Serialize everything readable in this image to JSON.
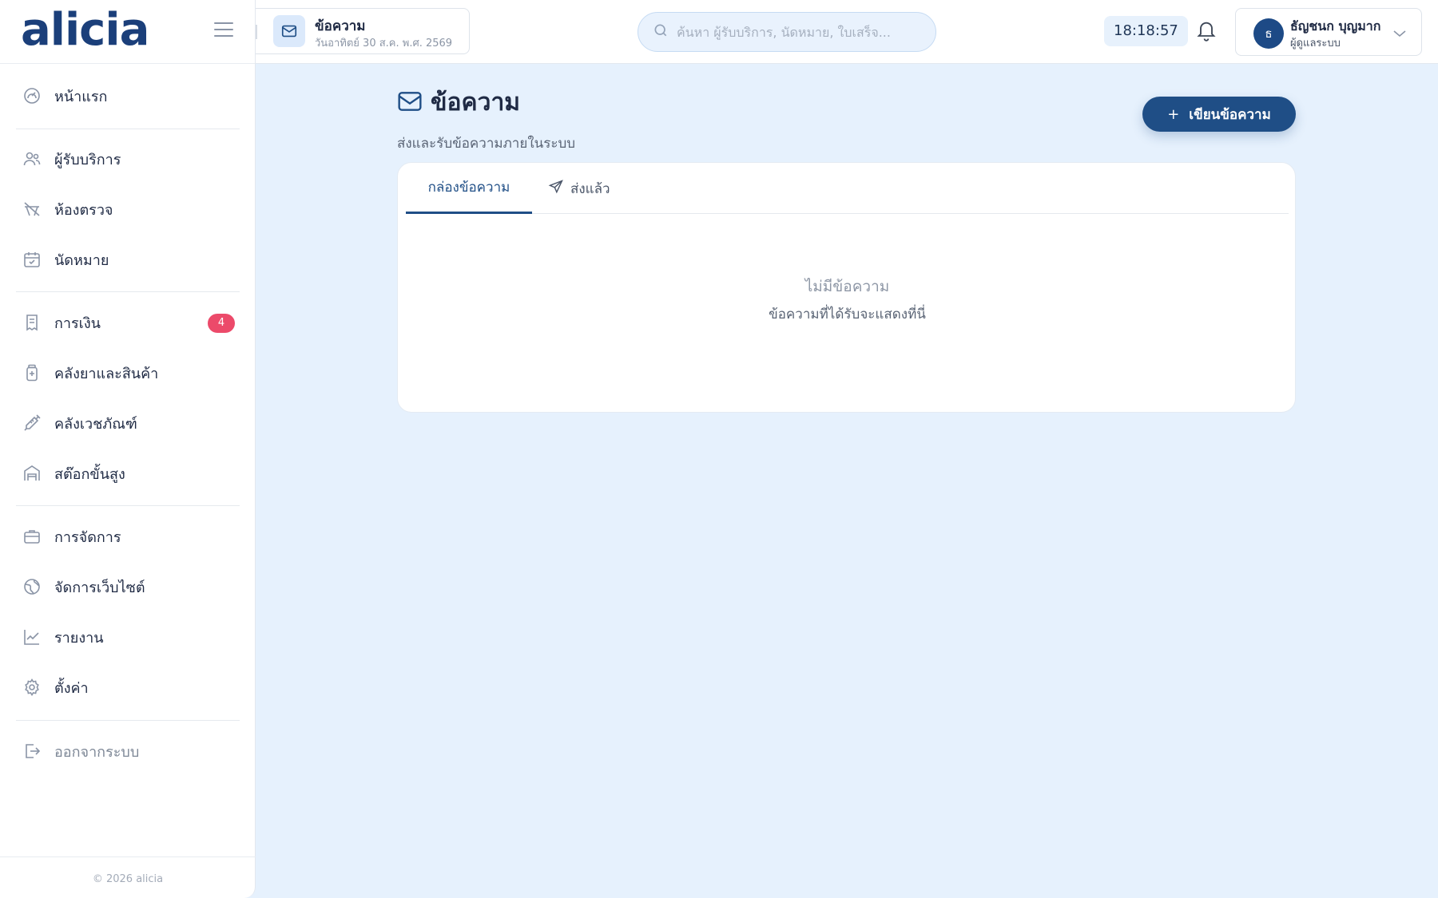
{
  "brand": {
    "logo_text": "alicia",
    "footer": "© 2026 alicia"
  },
  "sidebar": {
    "items": [
      {
        "label": "หน้าแรก",
        "icon": "dashboard-gauge-icon"
      },
      {
        "label": "ผู้รับบริการ",
        "icon": "users-icon"
      },
      {
        "label": "ห้องตรวจ",
        "icon": "exam-room-icon"
      },
      {
        "label": "นัดหมาย",
        "icon": "calendar-check-icon"
      },
      {
        "label": "การเงิน",
        "icon": "receipt-icon",
        "badge": "4"
      },
      {
        "label": "คลังยาและสินค้า",
        "icon": "medicine-bottle-icon"
      },
      {
        "label": "คลังเวชภัณฑ์",
        "icon": "syringe-icon"
      },
      {
        "label": "สต๊อกขั้นสูง",
        "icon": "warehouse-icon"
      },
      {
        "label": "การจัดการ",
        "icon": "briefcase-icon"
      },
      {
        "label": "จัดการเว็บไซต์",
        "icon": "globe-icon"
      },
      {
        "label": "รายงาน",
        "icon": "chart-line-icon"
      },
      {
        "label": "ตั้งค่า",
        "icon": "gear-icon"
      }
    ],
    "logout_label": "ออกจากระบบ"
  },
  "topbar": {
    "page_chip_title": "ข้อความ",
    "page_chip_date": "วันอาทิตย์ 30 ส.ค. พ.ศ. 2569",
    "search_placeholder": "ค้นหา ผู้รับบริการ, นัดหมาย, ใบเสร็จ...",
    "clock": "18:18:57",
    "user_initial": "ธ",
    "user_name": "ธัญชนก บุญมาก",
    "user_role": "ผู้ดูแลระบบ"
  },
  "main": {
    "title": "ข้อความ",
    "subtitle": "ส่งและรับข้อความภายในระบบ",
    "compose_plus": "+",
    "compose_label": "เขียนข้อความ",
    "tabs": [
      {
        "label": "กล่องข้อความ"
      },
      {
        "label": "ส่งแล้ว"
      }
    ],
    "empty_title": "ไม่มีข้อความ",
    "empty_desc": "ข้อความที่ได้รับจะแสดงที่นี่"
  },
  "colors": {
    "accent": "#1f4e86",
    "badge": "#ec4a6a",
    "background": "#e6f1fd"
  }
}
